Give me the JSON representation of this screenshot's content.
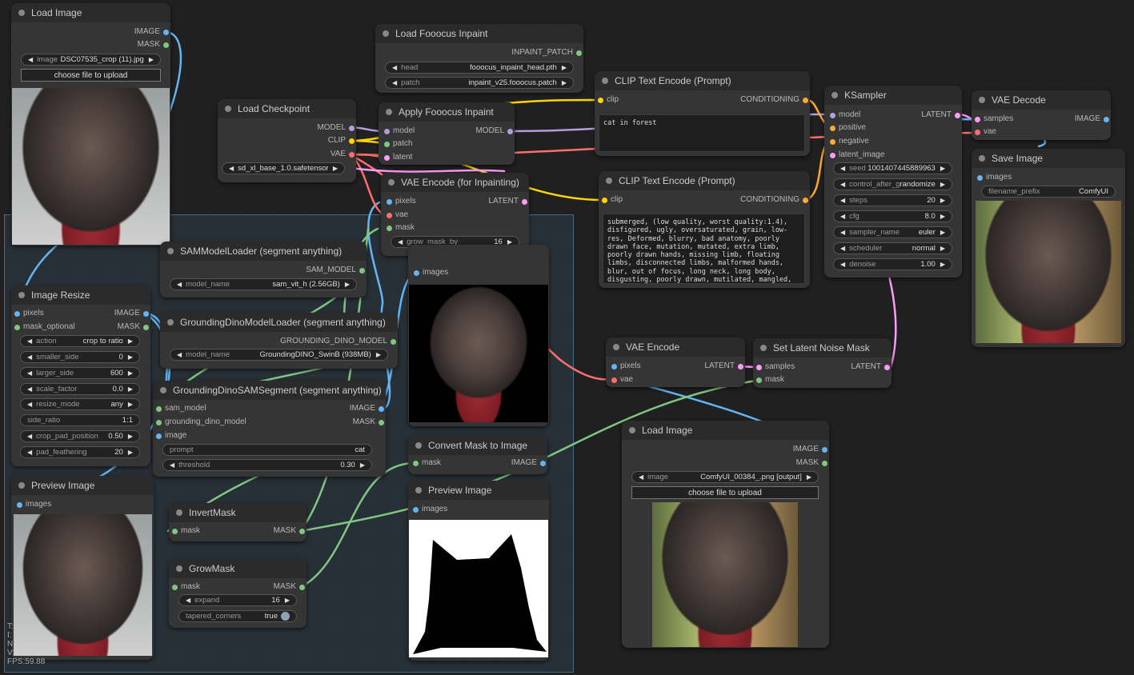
{
  "colors": {
    "image": "#64b5f6",
    "mask": "#81c784",
    "model": "#b39ddb",
    "clip": "#ffd500",
    "vae": "#ff6e6e",
    "conditioning": "#ffa931",
    "latent": "#ff9cf9",
    "patch": "#81c784",
    "sam": "#81c784",
    "dino": "#81c784"
  },
  "nodes": {
    "load_image_1": {
      "title": "Load Image",
      "out_image": "IMAGE",
      "out_mask": "MASK",
      "w_image_label": "image",
      "w_image_value": "DSC07535_crop (11).jpg",
      "upload": "choose file to upload"
    },
    "load_fooocus": {
      "title": "Load Fooocus Inpaint",
      "out_patch": "INPAINT_PATCH",
      "w_head_label": "head",
      "w_head_value": "fooocus_inpaint_head.pth",
      "w_patch_label": "patch",
      "w_patch_value": "inpaint_v25.fooocus.patch"
    },
    "load_checkpoint": {
      "title": "Load Checkpoint",
      "out_model": "MODEL",
      "out_clip": "CLIP",
      "out_vae": "VAE",
      "w_ckpt_label": "ckpt_name",
      "w_ckpt_value": "sd_xl_base_1.0.safetensors"
    },
    "apply_fooocus": {
      "title": "Apply Fooocus Inpaint",
      "in_model": "model",
      "in_patch": "patch",
      "in_latent": "latent",
      "out_model": "MODEL"
    },
    "vae_encode_inpaint": {
      "title": "VAE Encode (for Inpainting)",
      "in_pixels": "pixels",
      "in_vae": "vae",
      "in_mask": "mask",
      "out_latent": "LATENT",
      "w_grow_label": "grow_mask_by",
      "w_grow_value": "16"
    },
    "clip_pos": {
      "title": "CLIP Text Encode (Prompt)",
      "in_clip": "clip",
      "out_cond": "CONDITIONING",
      "text": "cat in forest"
    },
    "clip_neg": {
      "title": "CLIP Text Encode (Prompt)",
      "in_clip": "clip",
      "out_cond": "CONDITIONING",
      "text": "submerged, (low quality, worst quality:1.4), disfigured, ugly, oversaturated, grain, low-res, Deformed, blurry, bad anatomy, poorly drawn face, mutation, mutated, extra limb, poorly drawn hands, missing limb, floating limbs, disconnected limbs, malformed hands, blur, out of focus, long neck, long body, disgusting, poorly drawn, mutilated, mangled, surreal, text"
    },
    "ksampler": {
      "title": "KSampler",
      "in_model": "model",
      "in_positive": "positive",
      "in_negative": "negative",
      "in_latent": "latent_image",
      "out_latent": "LATENT",
      "widgets": [
        {
          "label": "seed",
          "value": "1001407445889963"
        },
        {
          "label": "control_after_generate",
          "value": "randomize"
        },
        {
          "label": "steps",
          "value": "20"
        },
        {
          "label": "cfg",
          "value": "8.0"
        },
        {
          "label": "sampler_name",
          "value": "euler"
        },
        {
          "label": "scheduler",
          "value": "normal"
        },
        {
          "label": "denoise",
          "value": "1.00"
        }
      ]
    },
    "vae_decode": {
      "title": "VAE Decode",
      "in_samples": "samples",
      "in_vae": "vae",
      "out_image": "IMAGE"
    },
    "save_image": {
      "title": "Save Image",
      "in_images": "images",
      "w_prefix_label": "filename_prefix",
      "w_prefix_value": "ComfyUI"
    },
    "sam_loader": {
      "title": "SAMModelLoader (segment anything)",
      "out_sam": "SAM_MODEL",
      "w_label": "model_name",
      "w_value": "sam_vit_h (2.56GB)"
    },
    "dino_loader": {
      "title": "GroundingDinoModelLoader (segment anything)",
      "out_dino": "GROUNDING_DINO_MODEL",
      "w_label": "model_name",
      "w_value": "GroundingDINO_SwinB (938MB)"
    },
    "dino_sam": {
      "title": "GroundingDinoSAMSegment (segment anything)",
      "in_sam": "sam_model",
      "in_dino": "grounding_dino_model",
      "in_image": "image",
      "out_image": "IMAGE",
      "out_mask": "MASK",
      "w_prompt_label": "prompt",
      "w_prompt_value": "cat",
      "w_thr_label": "threshold",
      "w_thr_value": "0.30"
    },
    "image_resize": {
      "title": "Image Resize",
      "in_pixels": "pixels",
      "in_mask": "mask_optional",
      "out_image": "IMAGE",
      "out_mask": "MASK",
      "widgets": [
        {
          "label": "action",
          "value": "crop to ratio"
        },
        {
          "label": "smaller_side",
          "value": "0"
        },
        {
          "label": "larger_side",
          "value": "600"
        },
        {
          "label": "scale_factor",
          "value": "0.0"
        },
        {
          "label": "resize_mode",
          "value": "any"
        },
        {
          "label": "side_ratio",
          "value": "1:1"
        },
        {
          "label": "crop_pad_position",
          "value": "0.50"
        },
        {
          "label": "pad_feathering",
          "value": "20"
        }
      ]
    },
    "preview_1": {
      "title": "Preview Image",
      "in_images": "images"
    },
    "preview_top": {
      "in_images": "images"
    },
    "invert_mask": {
      "title": "InvertMask",
      "in_mask": "mask",
      "out_mask": "MASK"
    },
    "grow_mask": {
      "title": "GrowMask",
      "in_mask": "mask",
      "out_mask": "MASK",
      "w_expand_label": "expand",
      "w_expand_value": "16",
      "w_taper_label": "tapered_corners",
      "w_taper_value": "true"
    },
    "convert_mask": {
      "title": "Convert Mask to Image",
      "in_mask": "mask",
      "out_image": "IMAGE"
    },
    "preview_mask": {
      "title": "Preview Image",
      "in_images": "images"
    },
    "vae_encode": {
      "title": "VAE Encode",
      "in_pixels": "pixels",
      "in_vae": "vae",
      "out_latent": "LATENT"
    },
    "set_noise_mask": {
      "title": "Set Latent Noise Mask",
      "in_samples": "samples",
      "in_mask": "mask",
      "out_latent": "LATENT"
    },
    "load_image_2": {
      "title": "Load Image",
      "out_image": "IMAGE",
      "out_mask": "MASK",
      "w_image_label": "image",
      "w_image_value": "ComfyUI_00384_.png [output]",
      "upload": "choose file to upload"
    }
  },
  "stats": {
    "t": "T:",
    "i": "I:",
    "n": "N:",
    "v": "V:",
    "fps": "FPS:59.88"
  }
}
